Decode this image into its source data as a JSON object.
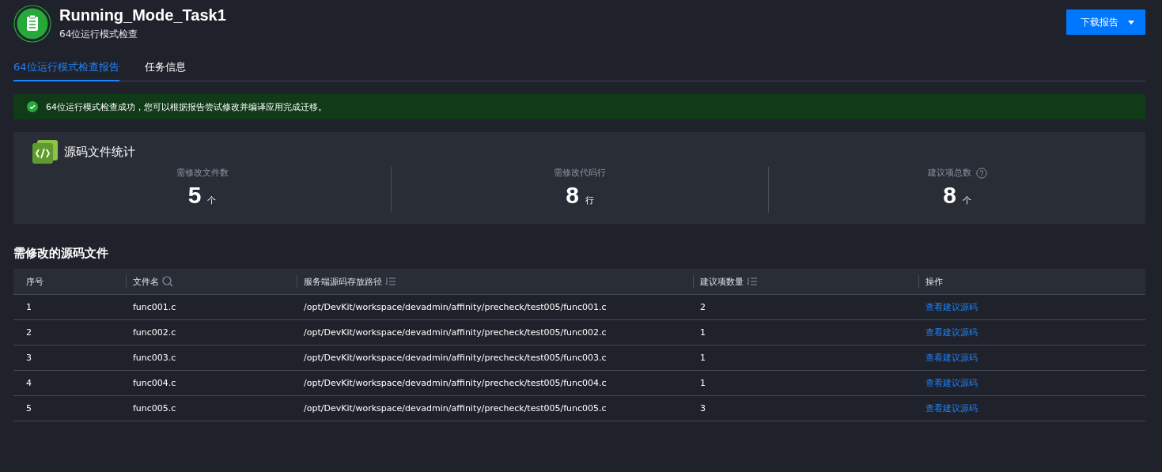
{
  "header": {
    "title": "Running_Mode_Task1",
    "subtitle": "64位运行模式检查",
    "download_button": "下载报告"
  },
  "tabs": [
    {
      "label": "64位运行模式检查报告",
      "selected": true
    },
    {
      "label": "任务信息",
      "selected": false
    }
  ],
  "alert": {
    "kind": "success",
    "message": "64位运行模式检查成功，您可以根据报告尝试修改并编译应用完成迁移。"
  },
  "stats": {
    "title": "源码文件统计",
    "items": [
      {
        "label": "需修改文件数",
        "value": "5",
        "unit": "个",
        "help": false
      },
      {
        "label": "需修改代码行",
        "value": "8",
        "unit": "行",
        "help": false
      },
      {
        "label": "建议项总数",
        "value": "8",
        "unit": "个",
        "help": true
      }
    ]
  },
  "table": {
    "title": "需修改的源码文件",
    "columns": [
      {
        "label": "序号",
        "kind": "plain"
      },
      {
        "label": "文件名",
        "kind": "search"
      },
      {
        "label": "服务端源码存放路径",
        "kind": "sort"
      },
      {
        "label": "建议项数量",
        "kind": "sort"
      },
      {
        "label": "操作",
        "kind": "plain"
      }
    ],
    "rows": [
      {
        "index": "1",
        "file": "func001.c",
        "path": "/opt/DevKit/workspace/devadmin/affinity/precheck/test005/func001.c",
        "count": "2",
        "action": "查看建议源码"
      },
      {
        "index": "2",
        "file": "func002.c",
        "path": "/opt/DevKit/workspace/devadmin/affinity/precheck/test005/func002.c",
        "count": "1",
        "action": "查看建议源码"
      },
      {
        "index": "3",
        "file": "func003.c",
        "path": "/opt/DevKit/workspace/devadmin/affinity/precheck/test005/func003.c",
        "count": "1",
        "action": "查看建议源码"
      },
      {
        "index": "4",
        "file": "func004.c",
        "path": "/opt/DevKit/workspace/devadmin/affinity/precheck/test005/func004.c",
        "count": "1",
        "action": "查看建议源码"
      },
      {
        "index": "5",
        "file": "func005.c",
        "path": "/opt/DevKit/workspace/devadmin/affinity/precheck/test005/func005.c",
        "count": "3",
        "action": "查看建议源码"
      }
    ]
  }
}
